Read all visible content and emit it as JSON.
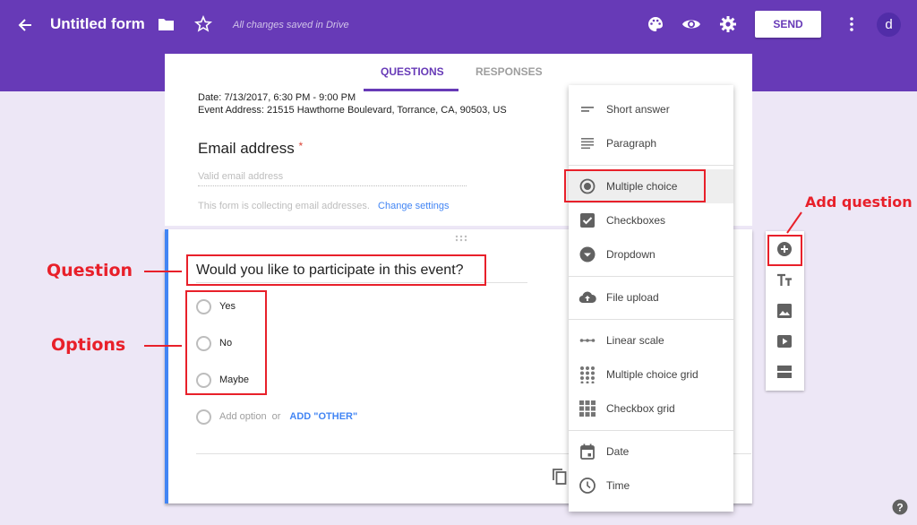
{
  "header": {
    "title": "Untitled form",
    "save_status": "All changes saved in Drive",
    "send_label": "SEND",
    "avatar_initial": "d",
    "icons": [
      "back-arrow-icon",
      "folder-icon",
      "star-icon",
      "palette-icon",
      "eye-icon",
      "gear-icon",
      "more-vert-icon"
    ]
  },
  "tabs": [
    {
      "label": "QUESTIONS",
      "active": true
    },
    {
      "label": "RESPONSES",
      "active": false
    }
  ],
  "description": {
    "line1": "Date: 7/13/2017, 6:30 PM - 9:00 PM",
    "line2": "Event Address: 21515 Hawthorne Boulevard, Torrance, CA, 90503, US"
  },
  "email_section": {
    "label": "Email address",
    "required_mark": "*",
    "placeholder": "Valid email address",
    "collecting_note": "This form is collecting email addresses.",
    "change_link": "Change settings"
  },
  "question": {
    "title": "Would you like to participate in this event?",
    "options": [
      "Yes",
      "No",
      "Maybe"
    ],
    "add_option": "Add option",
    "or_text": "or",
    "add_other": "ADD \"OTHER\""
  },
  "type_menu": {
    "items": [
      {
        "label": "Short answer",
        "icon": "short-answer-icon"
      },
      {
        "label": "Paragraph",
        "icon": "paragraph-icon"
      },
      {
        "label": "Multiple choice",
        "icon": "radio-icon",
        "selected": true
      },
      {
        "label": "Checkboxes",
        "icon": "checkbox-icon"
      },
      {
        "label": "Dropdown",
        "icon": "dropdown-icon"
      },
      {
        "label": "File upload",
        "icon": "cloud-upload-icon"
      },
      {
        "label": "Linear scale",
        "icon": "linear-scale-icon"
      },
      {
        "label": "Multiple choice grid",
        "icon": "radio-grid-icon"
      },
      {
        "label": "Checkbox grid",
        "icon": "checkbox-grid-icon"
      },
      {
        "label": "Date",
        "icon": "calendar-icon"
      },
      {
        "label": "Time",
        "icon": "clock-icon"
      }
    ]
  },
  "side_toolbar": [
    "add-question-icon",
    "title-text-icon",
    "image-icon",
    "video-icon",
    "section-icon"
  ],
  "annotations": {
    "question": "Question",
    "options": "Options",
    "add_question": "Add question",
    "color": "#e8202a"
  },
  "colors": {
    "brand": "#673ab7",
    "background": "#ede7f6",
    "accent_blue": "#4285f4",
    "required": "#db4437"
  }
}
